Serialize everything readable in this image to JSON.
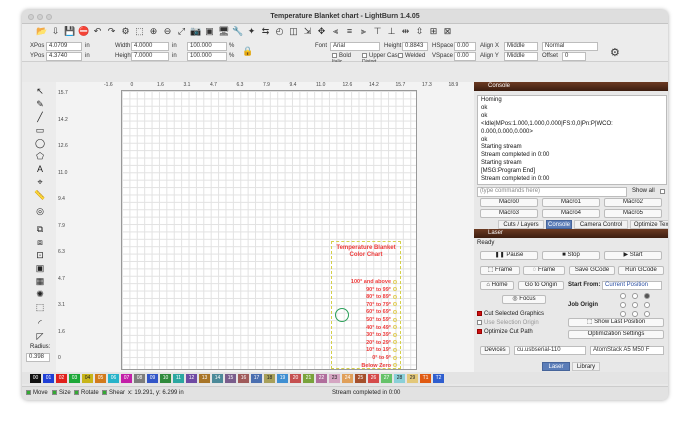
{
  "window": {
    "title": "Temperature Blanket chart - LightBurn 1.4.05"
  },
  "toolbar": {
    "icons": [
      "folder-open",
      "import",
      "save",
      "stop",
      "undo",
      "redo",
      "settings",
      "select-area",
      "zoom-in",
      "zoom-out",
      "zoom-fit",
      "camera",
      "frame",
      "monitor",
      "tools",
      "wand",
      "arrange",
      "spiral",
      "box",
      "resize",
      "move",
      "align-left",
      "align-center",
      "align-right",
      "align-top",
      "align-bottom",
      "distribute-h",
      "distribute-v",
      "group",
      "lock"
    ]
  },
  "props": {
    "xpos_label": "XPos",
    "xpos_value": "4.0709",
    "xpos_unit": "in",
    "ypos_label": "YPos",
    "ypos_value": "4.3740",
    "ypos_unit": "in",
    "width_label": "Width",
    "width_value": "4.0000",
    "width_unit": "in",
    "width_pct": "100.000",
    "pct": "%",
    "height_label": "Height",
    "height_value": "7.0000",
    "height_unit": "in",
    "height_pct": "100.000",
    "font_label": "Font",
    "font_value": "Arial",
    "fheight_label": "Height",
    "fheight_value": "0.8843",
    "hspace_label": "HSpace",
    "hspace_value": "0.00",
    "vspace_label": "VSpace",
    "vspace_value": "0.00",
    "alignx_label": "Align X",
    "alignx_value": "Middle",
    "normal": "Normal",
    "aligny_label": "Align Y",
    "aligny_value": "Middle",
    "offset_label": "Offset",
    "offset_value": "0",
    "bold": "Bold",
    "italic": "Italic",
    "uppercase": "Upper Case",
    "distort": "Distort",
    "welded": "Welded"
  },
  "ruler": {
    "top": [
      "-1.6",
      "0",
      "1.6",
      "3.1",
      "4.7",
      "6.3",
      "7.9",
      "9.4",
      "11.0",
      "12.6",
      "14.2",
      "15.7",
      "17.3",
      "18.9"
    ],
    "left": [
      "15.7",
      "14.2",
      "12.6",
      "11.0",
      "9.4",
      "7.9",
      "6.3",
      "4.7",
      "3.1",
      "1.6",
      "0"
    ]
  },
  "left_tools": {
    "radius_label": "Radius:",
    "radius_value": "0.398"
  },
  "chart": {
    "title1": "Temperature Blanket",
    "title2": "Color Chart",
    "rows": [
      "100° and above",
      "90° to 99°",
      "80° to 89°",
      "70° to 79°",
      "60° to 69°",
      "50° to 59°",
      "40° to 49°",
      "30° to 39°",
      "20° to 29°",
      "10° to 19°",
      "0° to 9°",
      "Below Zero"
    ]
  },
  "console": {
    "header": "Console",
    "lines": [
      "Homing",
      "ok",
      "ok",
      "<Idle|MPos:1.000,1.000,0.000|FS:0,0|Pn:P|WCO:",
      "0.000,0.000,0.000>",
      "ok",
      "Starting stream",
      "Stream completed in 0:00",
      "Starting stream",
      "[MSG:Program End]",
      "Stream completed in 0:00"
    ],
    "input_placeholder": "(type commands here)",
    "show_all": "Show all",
    "macros": [
      "Macro0",
      "Macro1",
      "Macro2",
      "Macro3",
      "Macro4",
      "Macro5"
    ]
  },
  "tabs1": [
    "Cuts / Layers",
    "Console",
    "Camera Control",
    "Optimize Text"
  ],
  "laser": {
    "header": "Laser",
    "state": "Ready",
    "pause": "Pause",
    "stop": "Stop",
    "start": "Start",
    "frame1": "Frame",
    "frame2": "Frame",
    "save_gcode": "Save GCode",
    "run_gcode": "Run GCode",
    "home": "Home",
    "go_origin": "Go to Origin",
    "start_from_label": "Start From:",
    "start_from": "Current Position",
    "focus": "Focus",
    "job_origin": "Job Origin",
    "cut_selected": "Cut Selected Graphics",
    "use_selection_origin": "Use Selection Origin",
    "optimize_cut": "Optimize Cut Path",
    "show_last": "Show Last Position",
    "opt_settings": "Optimization Settings",
    "devices": "Devices",
    "port": "cu.usbserial-110",
    "machine": "AtomStack A5 M50 F"
  },
  "tabs2": [
    "Laser",
    "Library"
  ],
  "palette": [
    {
      "l": "00",
      "c": "#111111"
    },
    {
      "l": "01",
      "c": "#1f3fd6"
    },
    {
      "l": "02",
      "c": "#e0201c"
    },
    {
      "l": "03",
      "c": "#1da838"
    },
    {
      "l": "04",
      "c": "#c8b51a"
    },
    {
      "l": "05",
      "c": "#d27a1b"
    },
    {
      "l": "06",
      "c": "#27b3c9"
    },
    {
      "l": "07",
      "c": "#c31fa8"
    },
    {
      "l": "08",
      "c": "#7d7d7d"
    },
    {
      "l": "09",
      "c": "#3356c8"
    },
    {
      "l": "10",
      "c": "#2f8a3c"
    },
    {
      "l": "11",
      "c": "#2ba7a1"
    },
    {
      "l": "12",
      "c": "#6f4aa3"
    },
    {
      "l": "13",
      "c": "#a87528"
    },
    {
      "l": "14",
      "c": "#4c8a99"
    },
    {
      "l": "15",
      "c": "#7a5d8c"
    },
    {
      "l": "16",
      "c": "#a05a5a"
    },
    {
      "l": "17",
      "c": "#4b6fb0"
    },
    {
      "l": "18",
      "c": "#a8a05a"
    },
    {
      "l": "19",
      "c": "#3f8fd2"
    },
    {
      "l": "20",
      "c": "#c55050"
    },
    {
      "l": "21",
      "c": "#79a33b"
    },
    {
      "l": "22",
      "c": "#b06e9c"
    },
    {
      "l": "23",
      "c": "#d5a5c2"
    },
    {
      "l": "24",
      "c": "#e0a05a"
    },
    {
      "l": "25",
      "c": "#a5502c"
    },
    {
      "l": "26",
      "c": "#d54a4a"
    },
    {
      "l": "27",
      "c": "#66c26a"
    },
    {
      "l": "28",
      "c": "#8ad0d8"
    },
    {
      "l": "29",
      "c": "#e3c87a"
    },
    {
      "l": "T1",
      "c": "#e05a12"
    },
    {
      "l": "T2",
      "c": "#2f5ecf"
    }
  ],
  "status": {
    "move": "Move",
    "size": "Size",
    "rotate": "Rotate",
    "shear": "Shear",
    "coords": "x: 19.291, y: 6.299 in",
    "message": "Stream completed in 0:00"
  }
}
